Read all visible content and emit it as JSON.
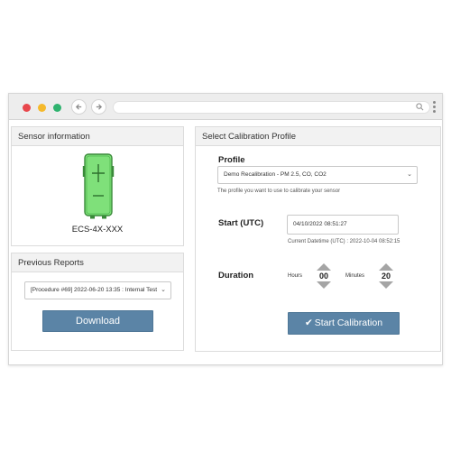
{
  "colors": {
    "accent": "#5b84a6",
    "device_fill": "#7fe07a",
    "traffic_red": "#e8474c",
    "traffic_yellow": "#f5b92b",
    "traffic_green": "#2fb36f"
  },
  "browser": {
    "icons": {
      "back": "arrow-left-icon",
      "forward": "arrow-right-icon",
      "search": "search-icon",
      "menu": "kebab-menu-icon"
    }
  },
  "sensor_panel": {
    "title": "Sensor information",
    "sensor_name": "ECS-4X-XXX",
    "icon": "sensor-device-icon"
  },
  "reports_panel": {
    "title": "Previous Reports",
    "selected_report": "[Procedure #69] 2022-06-20 13:35 : Internal Test",
    "download_label": "Download"
  },
  "calibration_panel": {
    "title": "Select Calibration Profile",
    "profile_label": "Profile",
    "profile_selected": "Demo Recalibration - PM 2.5, CO, CO2",
    "profile_hint": "The profile you want to use to calibrate your sensor",
    "start_label": "Start (UTC)",
    "start_value": "04/10/2022 08:51:27",
    "start_hint": "Current Datetime (UTC) : 2022-10-04 08:52:15",
    "duration_label": "Duration",
    "hours_label": "Hours",
    "hours_value": "00",
    "minutes_label": "Minutes",
    "minutes_value": "20",
    "start_button_label": "Start Calibration",
    "start_button_icon": "check-icon"
  }
}
